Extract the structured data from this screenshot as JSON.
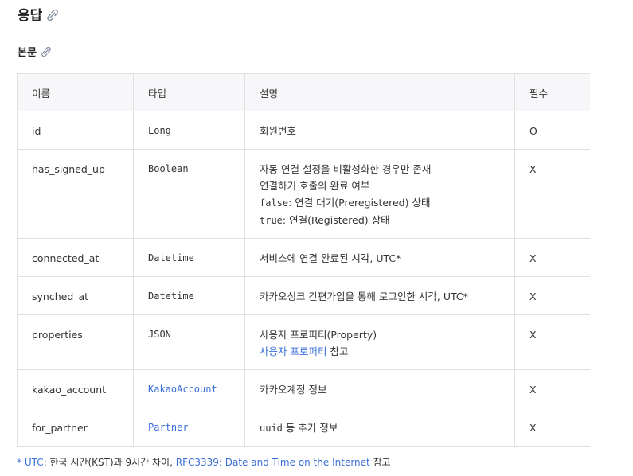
{
  "response_heading": "응답",
  "body_heading": "본문",
  "table": {
    "headers": [
      "이름",
      "타입",
      "설명",
      "필수"
    ],
    "rows": [
      {
        "name": "id",
        "type": "Long",
        "type_link": false,
        "desc": [
          {
            "parts": [
              {
                "t": "회원번호"
              }
            ]
          }
        ],
        "required": "O"
      },
      {
        "name": "has_signed_up",
        "type": "Boolean",
        "type_link": false,
        "desc": [
          {
            "parts": [
              {
                "t": "자동 연결 설정을 비활성화한 경우만 존재"
              }
            ]
          },
          {
            "parts": [
              {
                "t": "연결하기 호출의 완료 여부"
              }
            ]
          },
          {
            "parts": [
              {
                "t": "false",
                "mono": true
              },
              {
                "t": ": 연결 대기(Preregistered) 상태"
              }
            ]
          },
          {
            "parts": [
              {
                "t": "true",
                "mono": true
              },
              {
                "t": ": 연결(Registered) 상태"
              }
            ]
          }
        ],
        "required": "X"
      },
      {
        "name": "connected_at",
        "type": "Datetime",
        "type_link": false,
        "desc": [
          {
            "parts": [
              {
                "t": "서비스에 연결 완료된 시각, UTC*"
              }
            ]
          }
        ],
        "required": "X"
      },
      {
        "name": "synched_at",
        "type": "Datetime",
        "type_link": false,
        "desc": [
          {
            "parts": [
              {
                "t": "카카오싱크 간편가입을 통해 로그인한 시각, UTC*"
              }
            ]
          }
        ],
        "required": "X"
      },
      {
        "name": "properties",
        "type": "JSON",
        "type_link": false,
        "desc": [
          {
            "parts": [
              {
                "t": "사용자 프로퍼티(Property)"
              }
            ]
          },
          {
            "parts": [
              {
                "t": "사용자 프로퍼티",
                "link": true
              },
              {
                "t": " 참고"
              }
            ]
          }
        ],
        "required": "X"
      },
      {
        "name": "kakao_account",
        "type": "KakaoAccount",
        "type_link": true,
        "desc": [
          {
            "parts": [
              {
                "t": "카카오계정 정보"
              }
            ]
          }
        ],
        "required": "X"
      },
      {
        "name": "for_partner",
        "type": "Partner",
        "type_link": true,
        "desc": [
          {
            "parts": [
              {
                "t": "uuid",
                "mono": true
              },
              {
                "t": " 등 추가 정보"
              }
            ]
          }
        ],
        "required": "X"
      }
    ]
  },
  "footnote": {
    "star": "* ",
    "utc_link": "UTC",
    "text1": ": 한국 시간(KST)과 9시간 차이, ",
    "rfc_link": "RFC3339: Date and Time on the Internet",
    "text2": " 참고"
  },
  "colors": {
    "link": "#3a6fd8",
    "header_bg": "#f7f7f9",
    "border": "#e1e1e1",
    "icon": "#8a94a6"
  }
}
